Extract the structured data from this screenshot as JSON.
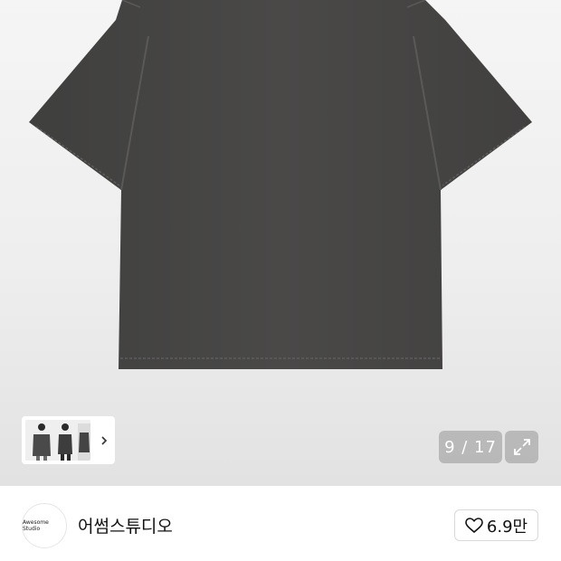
{
  "gallery": {
    "product_image": "dark-gray-pigment-tshirt",
    "counter": "9 / 17",
    "thumbnail": "model-wearing-tshirt-thumbnails",
    "icons": {
      "next": "chevron-right-icon",
      "expand": "expand-arrows-icon"
    }
  },
  "shop": {
    "logo_text": "Awesome Studio",
    "name": "어썸스튜디오",
    "likes": "6.9만",
    "like_icon": "heart-icon"
  },
  "colors": {
    "shirt": "#474645",
    "counter_bg": "#969696",
    "background": "#ffffff"
  }
}
